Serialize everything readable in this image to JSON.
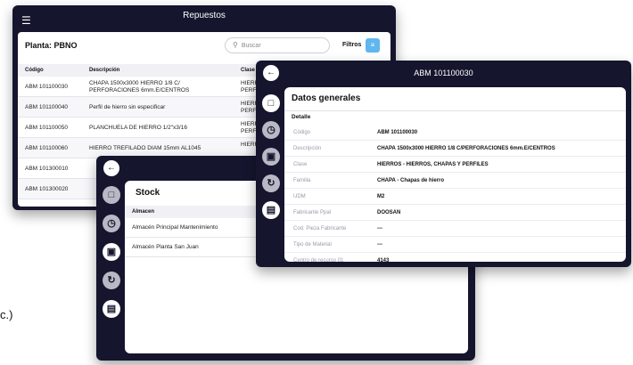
{
  "repuestos": {
    "title": "Repuestos",
    "menu_icon": "hamburger-icon",
    "plant_label": "Planta: PBNO",
    "search_placeholder": "Buscar",
    "filters_label": "Filtros",
    "columns": [
      "Código",
      "Descripción",
      "Clase"
    ],
    "rows": [
      {
        "code": "ABM 101100030",
        "desc": "CHAPA 1500x3000 HIERRO 1/8 C/ PERFORACIONES 6mm.E/CENTROS",
        "cls": "HIERR PERFI"
      },
      {
        "code": "ABM 101100040",
        "desc": "Perfil de hierro sin especificar",
        "cls": "HIERR PERFI"
      },
      {
        "code": "ABM 101100050",
        "desc": "PLANCHUELA DE HIERRO 1/2\"x3/16",
        "cls": "HIERR PERFI"
      },
      {
        "code": "ABM 101100060",
        "desc": "HIERRO TREFILADO DIAM 15mm AL1045",
        "cls": "HIERR"
      },
      {
        "code": "ABM 101300010",
        "desc": "",
        "cls": ""
      },
      {
        "code": "ABM 101300020",
        "desc": "",
        "cls": ""
      }
    ]
  },
  "stock": {
    "title": "Stock",
    "column": "Almacen",
    "rows": [
      "Almacén Principal Mantenimiento",
      "Almacén Planta San Juan"
    ]
  },
  "detail": {
    "title": "ABM 101100030",
    "section_title": "Datos generales",
    "subsection": "Detalle",
    "fields": [
      {
        "label": "Código",
        "value": "ABM 101100030"
      },
      {
        "label": "Descripción",
        "value": "CHAPA 1500x3000 HIERRO 1/8 C/PERFORACIONES 6mm.E/CENTROS"
      },
      {
        "label": "Clase",
        "value": "HIERROS - HIERROS, CHAPAS Y PERFILES"
      },
      {
        "label": "Familia",
        "value": "CHAPA - Chapas de hierro"
      },
      {
        "label": "UDM",
        "value": "M2"
      },
      {
        "label": "Fabricante Ppal",
        "value": "DOOSAN"
      },
      {
        "label": "Cod. Pieza Fabricante",
        "value": "---"
      },
      {
        "label": "Tipo de Material",
        "value": "---"
      },
      {
        "label": "Centro de recurso 01",
        "value": "4143"
      }
    ]
  },
  "cutoff_text": "c.)",
  "colors": {
    "panel_bg": "#15152e",
    "accent": "#5fb7ee"
  }
}
